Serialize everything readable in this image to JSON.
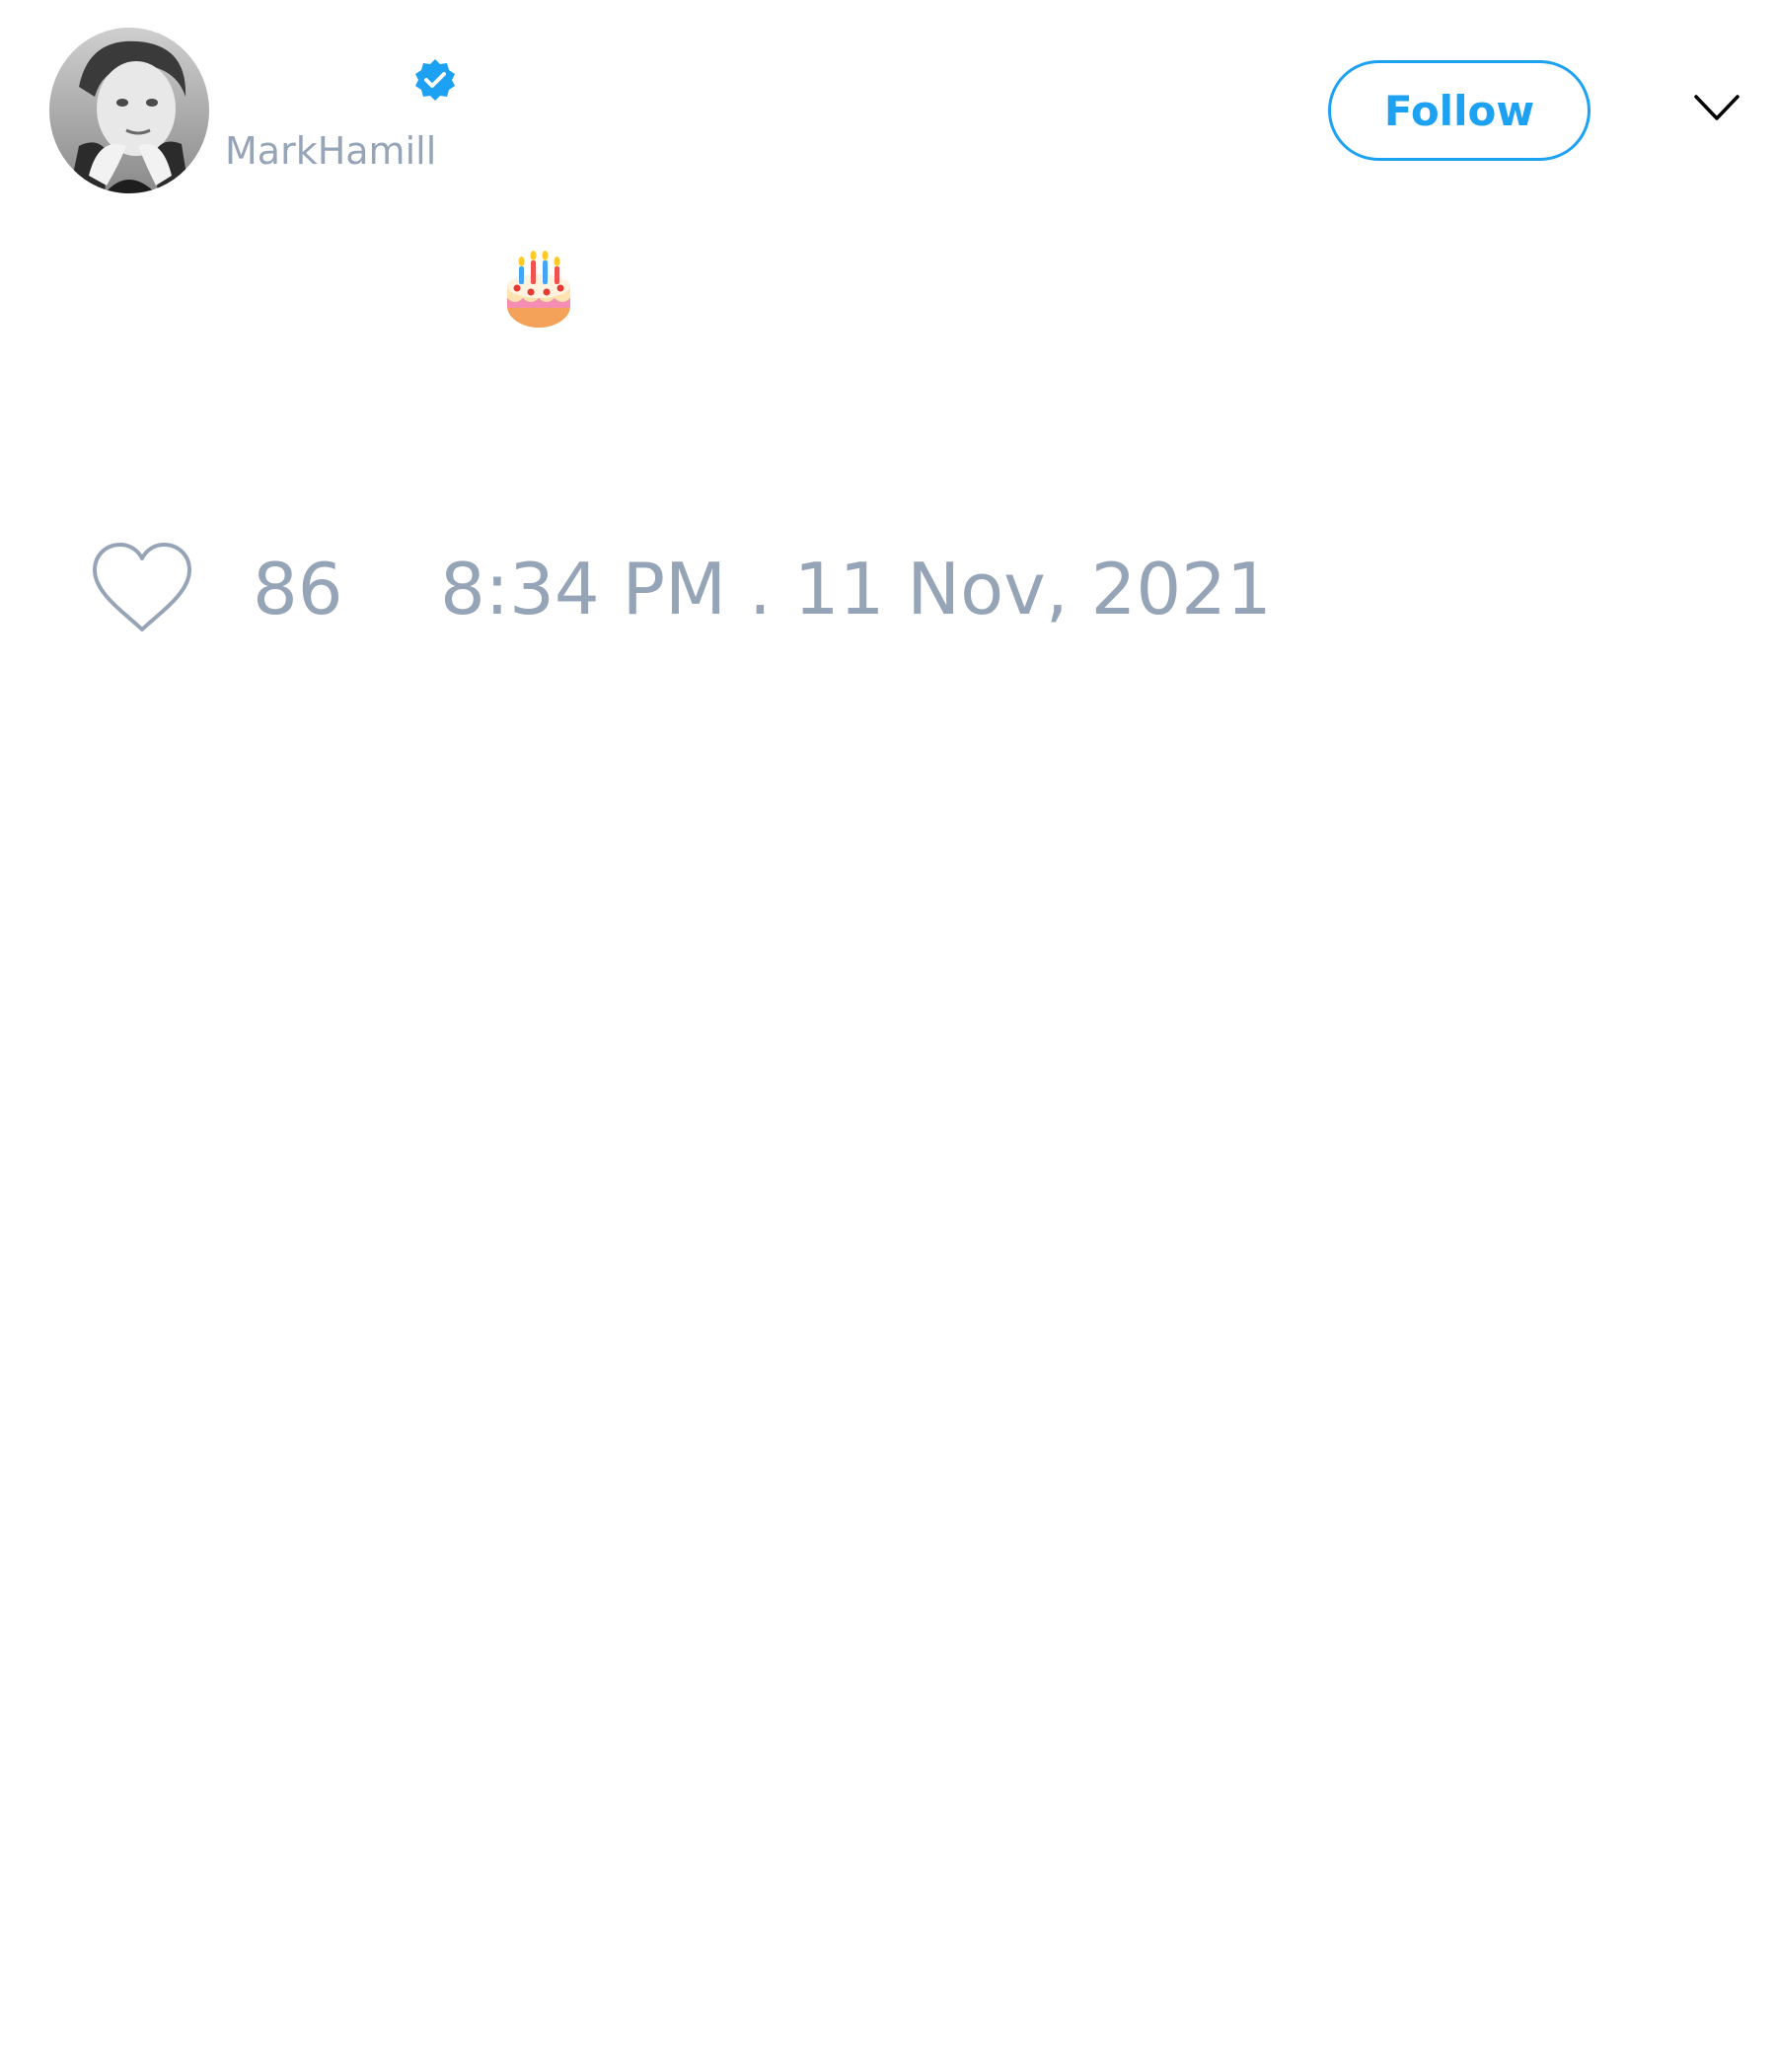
{
  "tweet": {
    "author": {
      "handle": "MarkHamill",
      "verified": true,
      "avatar_icon": "profile-photo",
      "verified_icon": "verified-badge-icon"
    },
    "follow_label": "Follow",
    "menu_icon": "chevron-down-icon",
    "text_emoji": "birthday-cake",
    "likes": "86",
    "timestamp": "8:34 PM . 11 Nov, 2021"
  },
  "colors": {
    "accent": "#1da1f2",
    "muted_text": "#96a4b7",
    "background": "#ffffff"
  }
}
